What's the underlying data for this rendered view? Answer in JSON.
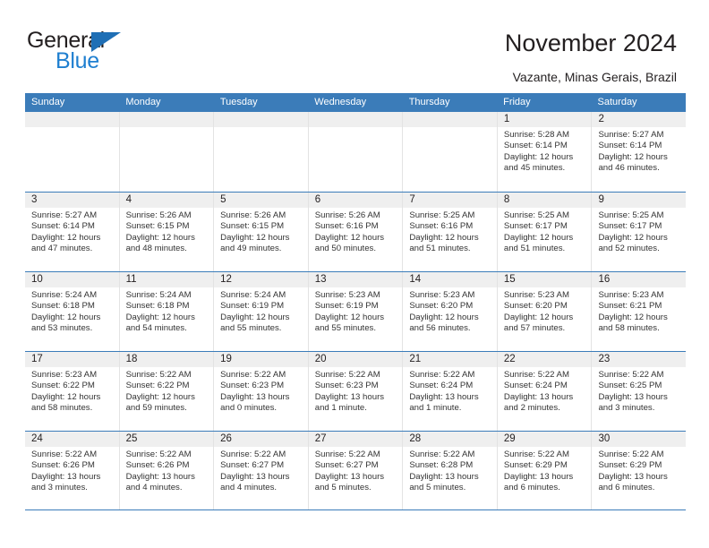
{
  "brand": {
    "name_top": "General",
    "name_bottom": "Blue"
  },
  "header": {
    "title": "November 2024",
    "subtitle": "Vazante, Minas Gerais, Brazil"
  },
  "colors": {
    "header_blue": "#3b7cb9",
    "logo_blue": "#1f7fd0",
    "daynum_band": "#efefef"
  },
  "weekdays": [
    "Sunday",
    "Monday",
    "Tuesday",
    "Wednesday",
    "Thursday",
    "Friday",
    "Saturday"
  ],
  "weeks": [
    [
      {
        "day": "",
        "empty": true
      },
      {
        "day": "",
        "empty": true
      },
      {
        "day": "",
        "empty": true
      },
      {
        "day": "",
        "empty": true
      },
      {
        "day": "",
        "empty": true
      },
      {
        "day": "1",
        "sunrise": "Sunrise: 5:28 AM",
        "sunset": "Sunset: 6:14 PM",
        "daylight1": "Daylight: 12 hours",
        "daylight2": "and 45 minutes."
      },
      {
        "day": "2",
        "sunrise": "Sunrise: 5:27 AM",
        "sunset": "Sunset: 6:14 PM",
        "daylight1": "Daylight: 12 hours",
        "daylight2": "and 46 minutes."
      }
    ],
    [
      {
        "day": "3",
        "sunrise": "Sunrise: 5:27 AM",
        "sunset": "Sunset: 6:14 PM",
        "daylight1": "Daylight: 12 hours",
        "daylight2": "and 47 minutes."
      },
      {
        "day": "4",
        "sunrise": "Sunrise: 5:26 AM",
        "sunset": "Sunset: 6:15 PM",
        "daylight1": "Daylight: 12 hours",
        "daylight2": "and 48 minutes."
      },
      {
        "day": "5",
        "sunrise": "Sunrise: 5:26 AM",
        "sunset": "Sunset: 6:15 PM",
        "daylight1": "Daylight: 12 hours",
        "daylight2": "and 49 minutes."
      },
      {
        "day": "6",
        "sunrise": "Sunrise: 5:26 AM",
        "sunset": "Sunset: 6:16 PM",
        "daylight1": "Daylight: 12 hours",
        "daylight2": "and 50 minutes."
      },
      {
        "day": "7",
        "sunrise": "Sunrise: 5:25 AM",
        "sunset": "Sunset: 6:16 PM",
        "daylight1": "Daylight: 12 hours",
        "daylight2": "and 51 minutes."
      },
      {
        "day": "8",
        "sunrise": "Sunrise: 5:25 AM",
        "sunset": "Sunset: 6:17 PM",
        "daylight1": "Daylight: 12 hours",
        "daylight2": "and 51 minutes."
      },
      {
        "day": "9",
        "sunrise": "Sunrise: 5:25 AM",
        "sunset": "Sunset: 6:17 PM",
        "daylight1": "Daylight: 12 hours",
        "daylight2": "and 52 minutes."
      }
    ],
    [
      {
        "day": "10",
        "sunrise": "Sunrise: 5:24 AM",
        "sunset": "Sunset: 6:18 PM",
        "daylight1": "Daylight: 12 hours",
        "daylight2": "and 53 minutes."
      },
      {
        "day": "11",
        "sunrise": "Sunrise: 5:24 AM",
        "sunset": "Sunset: 6:18 PM",
        "daylight1": "Daylight: 12 hours",
        "daylight2": "and 54 minutes."
      },
      {
        "day": "12",
        "sunrise": "Sunrise: 5:24 AM",
        "sunset": "Sunset: 6:19 PM",
        "daylight1": "Daylight: 12 hours",
        "daylight2": "and 55 minutes."
      },
      {
        "day": "13",
        "sunrise": "Sunrise: 5:23 AM",
        "sunset": "Sunset: 6:19 PM",
        "daylight1": "Daylight: 12 hours",
        "daylight2": "and 55 minutes."
      },
      {
        "day": "14",
        "sunrise": "Sunrise: 5:23 AM",
        "sunset": "Sunset: 6:20 PM",
        "daylight1": "Daylight: 12 hours",
        "daylight2": "and 56 minutes."
      },
      {
        "day": "15",
        "sunrise": "Sunrise: 5:23 AM",
        "sunset": "Sunset: 6:20 PM",
        "daylight1": "Daylight: 12 hours",
        "daylight2": "and 57 minutes."
      },
      {
        "day": "16",
        "sunrise": "Sunrise: 5:23 AM",
        "sunset": "Sunset: 6:21 PM",
        "daylight1": "Daylight: 12 hours",
        "daylight2": "and 58 minutes."
      }
    ],
    [
      {
        "day": "17",
        "sunrise": "Sunrise: 5:23 AM",
        "sunset": "Sunset: 6:22 PM",
        "daylight1": "Daylight: 12 hours",
        "daylight2": "and 58 minutes."
      },
      {
        "day": "18",
        "sunrise": "Sunrise: 5:22 AM",
        "sunset": "Sunset: 6:22 PM",
        "daylight1": "Daylight: 12 hours",
        "daylight2": "and 59 minutes."
      },
      {
        "day": "19",
        "sunrise": "Sunrise: 5:22 AM",
        "sunset": "Sunset: 6:23 PM",
        "daylight1": "Daylight: 13 hours",
        "daylight2": "and 0 minutes."
      },
      {
        "day": "20",
        "sunrise": "Sunrise: 5:22 AM",
        "sunset": "Sunset: 6:23 PM",
        "daylight1": "Daylight: 13 hours",
        "daylight2": "and 1 minute."
      },
      {
        "day": "21",
        "sunrise": "Sunrise: 5:22 AM",
        "sunset": "Sunset: 6:24 PM",
        "daylight1": "Daylight: 13 hours",
        "daylight2": "and 1 minute."
      },
      {
        "day": "22",
        "sunrise": "Sunrise: 5:22 AM",
        "sunset": "Sunset: 6:24 PM",
        "daylight1": "Daylight: 13 hours",
        "daylight2": "and 2 minutes."
      },
      {
        "day": "23",
        "sunrise": "Sunrise: 5:22 AM",
        "sunset": "Sunset: 6:25 PM",
        "daylight1": "Daylight: 13 hours",
        "daylight2": "and 3 minutes."
      }
    ],
    [
      {
        "day": "24",
        "sunrise": "Sunrise: 5:22 AM",
        "sunset": "Sunset: 6:26 PM",
        "daylight1": "Daylight: 13 hours",
        "daylight2": "and 3 minutes."
      },
      {
        "day": "25",
        "sunrise": "Sunrise: 5:22 AM",
        "sunset": "Sunset: 6:26 PM",
        "daylight1": "Daylight: 13 hours",
        "daylight2": "and 4 minutes."
      },
      {
        "day": "26",
        "sunrise": "Sunrise: 5:22 AM",
        "sunset": "Sunset: 6:27 PM",
        "daylight1": "Daylight: 13 hours",
        "daylight2": "and 4 minutes."
      },
      {
        "day": "27",
        "sunrise": "Sunrise: 5:22 AM",
        "sunset": "Sunset: 6:27 PM",
        "daylight1": "Daylight: 13 hours",
        "daylight2": "and 5 minutes."
      },
      {
        "day": "28",
        "sunrise": "Sunrise: 5:22 AM",
        "sunset": "Sunset: 6:28 PM",
        "daylight1": "Daylight: 13 hours",
        "daylight2": "and 5 minutes."
      },
      {
        "day": "29",
        "sunrise": "Sunrise: 5:22 AM",
        "sunset": "Sunset: 6:29 PM",
        "daylight1": "Daylight: 13 hours",
        "daylight2": "and 6 minutes."
      },
      {
        "day": "30",
        "sunrise": "Sunrise: 5:22 AM",
        "sunset": "Sunset: 6:29 PM",
        "daylight1": "Daylight: 13 hours",
        "daylight2": "and 6 minutes."
      }
    ]
  ]
}
